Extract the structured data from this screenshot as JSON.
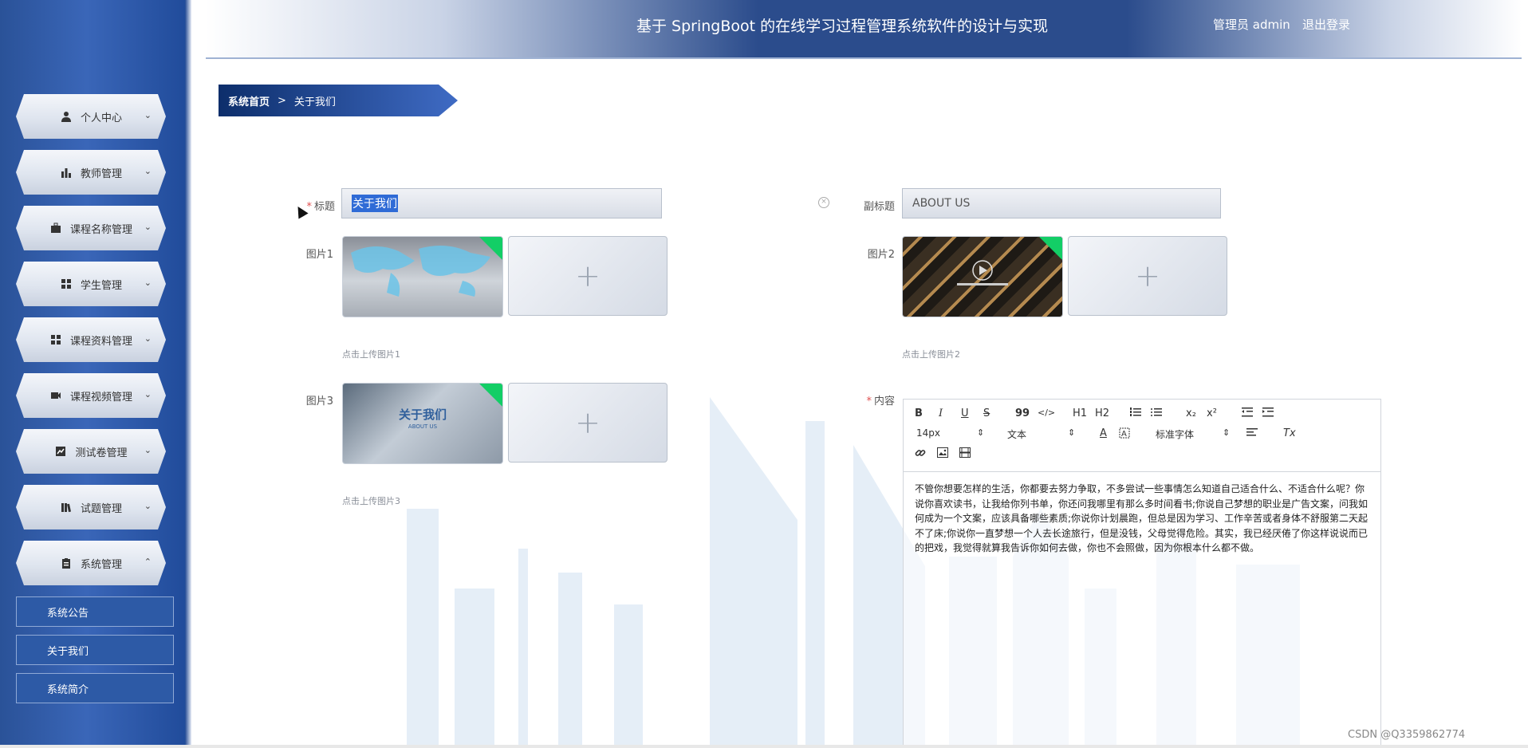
{
  "header": {
    "title": "基于 SpringBoot 的在线学习过程管理系统软件的设计与实现",
    "user": "管理员 admin",
    "logout": "退出登录"
  },
  "sidebar": {
    "items": [
      {
        "label": "个人中心",
        "icon": "user-icon"
      },
      {
        "label": "教师管理",
        "icon": "bar-chart-icon"
      },
      {
        "label": "课程名称管理",
        "icon": "briefcase-icon"
      },
      {
        "label": "学生管理",
        "icon": "grid-icon"
      },
      {
        "label": "课程资料管理",
        "icon": "grid-icon"
      },
      {
        "label": "课程视频管理",
        "icon": "video-camera-icon"
      },
      {
        "label": "测试卷管理",
        "icon": "line-chart-icon"
      },
      {
        "label": "试题管理",
        "icon": "books-icon"
      },
      {
        "label": "系统管理",
        "icon": "clipboard-icon"
      }
    ],
    "subitems": [
      "系统公告",
      "关于我们",
      "系统简介"
    ]
  },
  "breadcrumb": {
    "home": "系统首页",
    "separator": ">",
    "current": "关于我们"
  },
  "form": {
    "title_label": "标题",
    "title_value": "关于我们",
    "subtitle_label": "副标题",
    "subtitle_value": "ABOUT US",
    "pic1_label": "图片1",
    "pic1_hint": "点击上传图片1",
    "pic2_label": "图片2",
    "pic2_hint": "点击上传图片2",
    "pic3_label": "图片3",
    "pic3_hint": "点击上传图片3",
    "pic3_image_text": "关于我们",
    "pic3_image_subtext": "ABOUT US",
    "content_label": "内容",
    "upload_plus": "+"
  },
  "editor": {
    "toolbar": {
      "bold": "B",
      "italic": "I",
      "underline": "U",
      "strike": "S",
      "quote": "99",
      "code": "</>",
      "h1": "H1",
      "h2": "H2",
      "sub": "x₂",
      "sup": "x²",
      "size": "14px",
      "size_arrow": "⇕",
      "text_type": "文本",
      "font": "标准字体",
      "color": "A",
      "clear": "Tx"
    },
    "content": "不管你想要怎样的生活，你都要去努力争取，不多尝试一些事情怎么知道自己适合什么、不适合什么呢？你说你喜欢读书，让我给你列书单，你还问我哪里有那么多时间看书;你说自己梦想的职业是广告文案，问我如何成为一个文案，应该具备哪些素质;你说你计划晨跑，但总是因为学习、工作辛苦或者身体不舒服第二天起不了床;你说你一直梦想一个人去长途旅行，但是没钱，父母觉得危险。其实，我已经厌倦了你这样说说而已的把戏，我觉得就算我告诉你如何去做，你也不会照做，因为你根本什么都不做。"
  },
  "watermark": "CSDN @Q3359862774",
  "colors": {
    "accent": "#2b4c8c",
    "sidebar": "#3a66b8",
    "required": "#e05050",
    "upload_badge": "#13ce66"
  }
}
